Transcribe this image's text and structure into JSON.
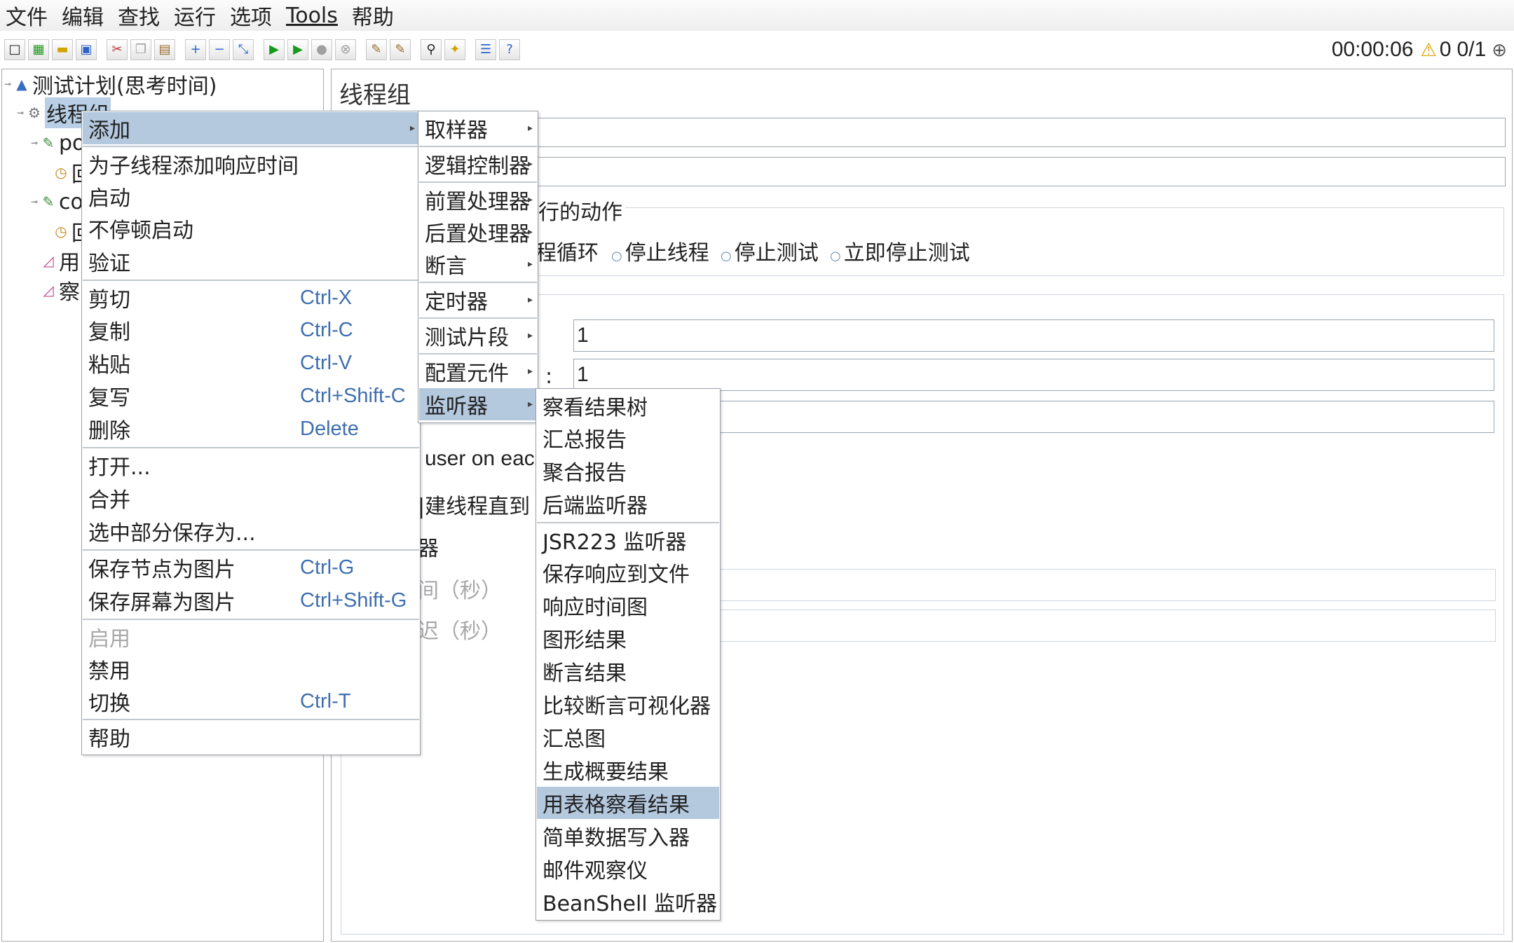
{
  "menubar": {
    "items": [
      "文件",
      "编辑",
      "查找",
      "运行",
      "选项",
      "Tools",
      "帮助"
    ]
  },
  "status": {
    "timer": "00:00:06",
    "warnings": "0",
    "threads": "0/1"
  },
  "tree": {
    "root": "测试计划(思考时间)",
    "thread_group": "线程组",
    "child_po": "po",
    "child_po_sub": "回",
    "child_co": "co",
    "child_co_sub": "回",
    "child_yong": "用",
    "child_cha": "察"
  },
  "panel": {
    "title": "线程组",
    "action_fragment": "行的动作",
    "radio_fragment": "程循环",
    "radio_stop_thread": "停止线程",
    "radio_stop_test": "停止测试",
    "radio_stop_now": "立即停止测试",
    "threads_value": "1",
    "colon": ":",
    "rampup_value": "1",
    "same_user_fragment": "user on eacl",
    "delay_fragment": "|建线程直到",
    "scheduler_fragment": "器",
    "duration_fragment": "间（秒）",
    "startup_delay_fragment": "迟（秒）"
  },
  "context_menu": {
    "add": "添加",
    "add_think_time": "为子线程添加响应时间",
    "start": "启动",
    "start_no_pause": "不停顿启动",
    "validate": "验证",
    "cut": "剪切",
    "cut_sc": "Ctrl-X",
    "copy": "复制",
    "copy_sc": "Ctrl-C",
    "paste": "粘贴",
    "paste_sc": "Ctrl-V",
    "duplicate": "复写",
    "duplicate_sc": "Ctrl+Shift-C",
    "delete": "删除",
    "delete_sc": "Delete",
    "open": "打开...",
    "merge": "合并",
    "save_selection": "选中部分保存为...",
    "save_node_image": "保存节点为图片",
    "save_node_image_sc": "Ctrl-G",
    "save_screen_image": "保存屏幕为图片",
    "save_screen_image_sc": "Ctrl+Shift-G",
    "enable": "启用",
    "disable": "禁用",
    "toggle": "切换",
    "toggle_sc": "Ctrl-T",
    "help": "帮助"
  },
  "add_menu": {
    "sampler": "取样器",
    "logic_controller": "逻辑控制器",
    "pre_processor": "前置处理器",
    "post_processor": "后置处理器",
    "assertion": "断言",
    "timer": "定时器",
    "test_fragment": "测试片段",
    "config_element": "配置元件",
    "listener": "监听器"
  },
  "listener_menu": {
    "items": [
      "察看结果树",
      "汇总报告",
      "聚合报告",
      "后端监听器",
      "JSR223 监听器",
      "保存响应到文件",
      "响应时间图",
      "图形结果",
      "断言结果",
      "比较断言可视化器",
      "汇总图",
      "生成概要结果",
      "用表格察看结果",
      "简单数据写入器",
      "邮件观察仪",
      "BeanShell 监听器"
    ]
  }
}
